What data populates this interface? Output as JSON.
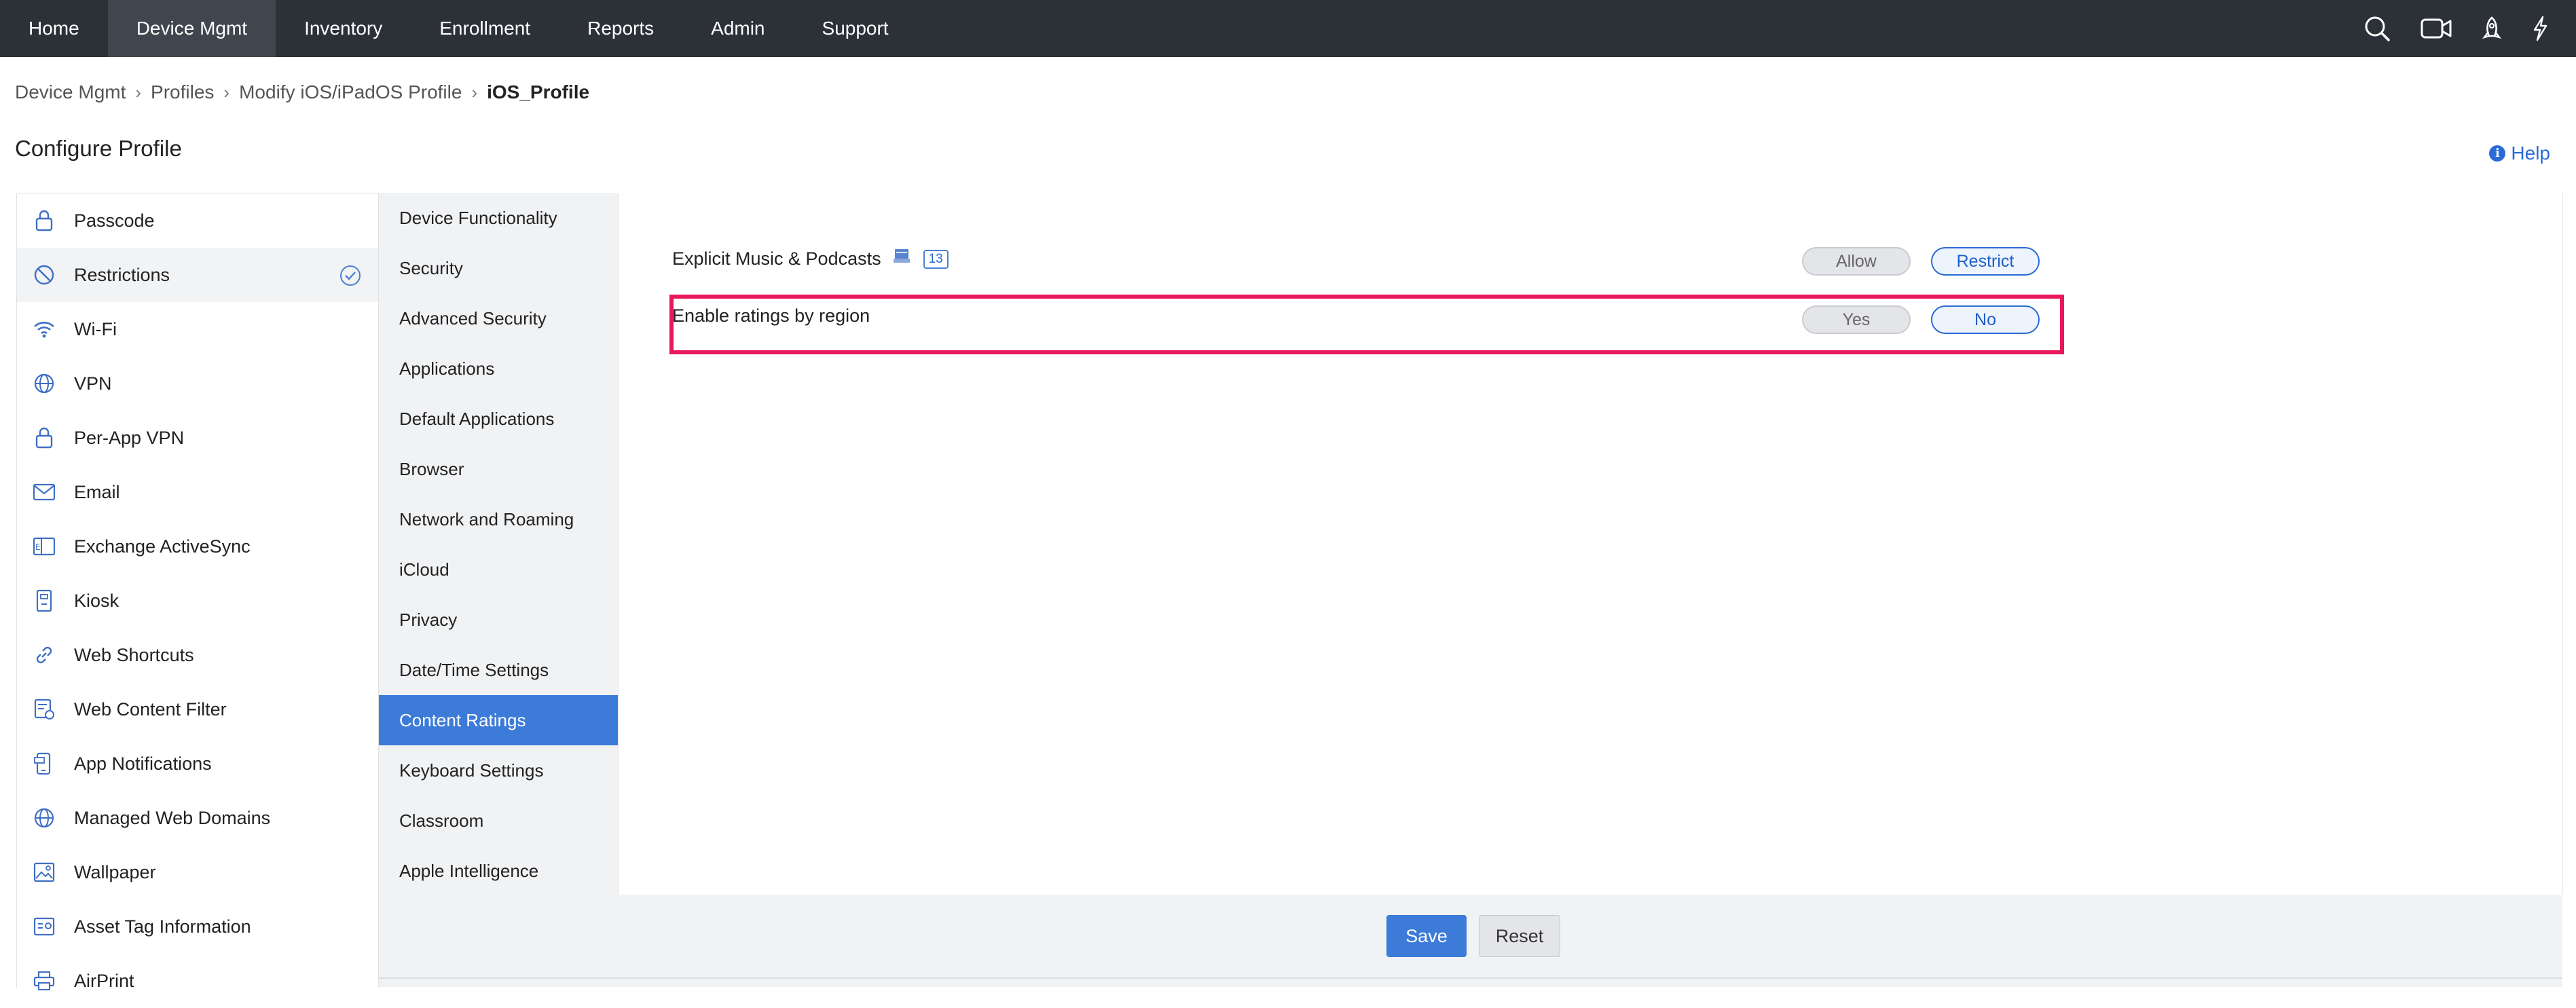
{
  "topnav": {
    "items": [
      {
        "label": "Home",
        "active": false
      },
      {
        "label": "Device Mgmt",
        "active": true
      },
      {
        "label": "Inventory",
        "active": false
      },
      {
        "label": "Enrollment",
        "active": false
      },
      {
        "label": "Reports",
        "active": false
      },
      {
        "label": "Admin",
        "active": false
      },
      {
        "label": "Support",
        "active": false
      }
    ],
    "icons": [
      "search-icon",
      "video-icon",
      "rocket-icon",
      "lightning-icon"
    ]
  },
  "breadcrumb": [
    "Device Mgmt",
    "Profiles",
    "Modify iOS/iPadOS Profile",
    "iOS_Profile"
  ],
  "page": {
    "title": "Configure Profile",
    "help_label": "Help",
    "help_icon_glyph": "i"
  },
  "sidebar": {
    "items": [
      {
        "label": "Passcode",
        "icon": "lock-icon"
      },
      {
        "label": "Restrictions",
        "icon": "restriction-icon",
        "active": true,
        "checked": true
      },
      {
        "label": "Wi-Fi",
        "icon": "wifi-icon"
      },
      {
        "label": "VPN",
        "icon": "globe-icon"
      },
      {
        "label": "Per-App VPN",
        "icon": "lock-icon"
      },
      {
        "label": "Email",
        "icon": "envelope-icon"
      },
      {
        "label": "Exchange ActiveSync",
        "icon": "exchange-icon"
      },
      {
        "label": "Kiosk",
        "icon": "kiosk-icon"
      },
      {
        "label": "Web Shortcuts",
        "icon": "link-icon"
      },
      {
        "label": "Web Content Filter",
        "icon": "filter-icon"
      },
      {
        "label": "App Notifications",
        "icon": "notification-icon"
      },
      {
        "label": "Managed Web Domains",
        "icon": "globe-icon"
      },
      {
        "label": "Wallpaper",
        "icon": "image-icon"
      },
      {
        "label": "Asset Tag Information",
        "icon": "tag-icon"
      },
      {
        "label": "AirPrint",
        "icon": "printer-icon"
      }
    ]
  },
  "subnav": {
    "items": [
      {
        "label": "Device Functionality"
      },
      {
        "label": "Security"
      },
      {
        "label": "Advanced Security"
      },
      {
        "label": "Applications"
      },
      {
        "label": "Default Applications"
      },
      {
        "label": "Browser"
      },
      {
        "label": "Network and Roaming"
      },
      {
        "label": "iCloud"
      },
      {
        "label": "Privacy"
      },
      {
        "label": "Date/Time Settings"
      },
      {
        "label": "Content Ratings",
        "active": true
      },
      {
        "label": "Keyboard Settings"
      },
      {
        "label": "Classroom"
      },
      {
        "label": "Apple Intelligence"
      }
    ]
  },
  "settings": [
    {
      "label": "Explicit Music & Podcasts",
      "icon": "device-icon",
      "badge": "13",
      "options": [
        "Allow",
        "Restrict"
      ],
      "selected": "Restrict"
    },
    {
      "label": "Enable ratings by region",
      "options": [
        "Yes",
        "No"
      ],
      "selected": "No",
      "highlighted": true,
      "highlight_color": "#e8195a"
    }
  ],
  "footer": {
    "save_label": "Save",
    "reset_label": "Reset"
  },
  "colors": {
    "accent": "#3d7bd9",
    "nav_bg": "#2c3138",
    "highlight": "#e8195a"
  }
}
